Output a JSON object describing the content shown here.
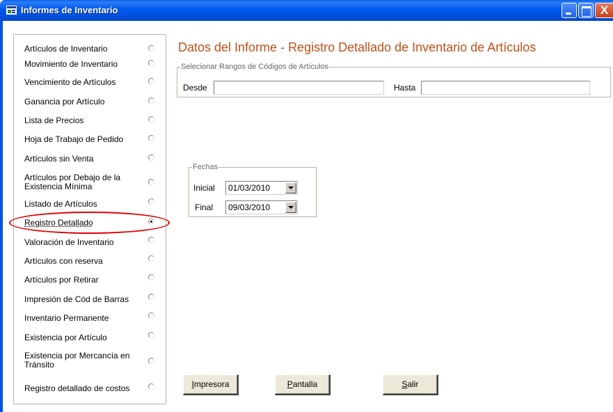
{
  "window": {
    "title": "Informes de Inventario",
    "close_glyph": "X"
  },
  "report_list": [
    {
      "label": "Artículos de Inventario",
      "selected": false
    },
    {
      "label": "Movimiento de Inventario",
      "selected": false
    },
    {
      "label": "Vencimiento de Artículos",
      "selected": false
    },
    {
      "label": "Ganancia por Artículo",
      "selected": false
    },
    {
      "label": "Lista de Precios",
      "selected": false
    },
    {
      "label": "Hoja de Trabajo de Pedido",
      "selected": false
    },
    {
      "label": "Artículos sin Venta",
      "selected": false
    },
    {
      "label": "Artículos por Debajo de la",
      "label2": "Existencia Mínima",
      "selected": false
    },
    {
      "label": "Listado de Artículos",
      "selected": false
    },
    {
      "label": "Registro Detallado",
      "selected": true
    },
    {
      "label": "Valoración de Inventario",
      "selected": false
    },
    {
      "label": "Artículos con reserva",
      "selected": false
    },
    {
      "label": "Artículos por Retirar",
      "selected": false
    },
    {
      "label": "Impresión de Cód de Barras",
      "selected": false
    },
    {
      "label": "Inventario Permanente",
      "selected": false
    },
    {
      "label": "Existencia por Artículo",
      "selected": false
    },
    {
      "label": "Existencia por Mercancía en",
      "label2": "Tránsito",
      "selected": false
    },
    {
      "label": "Registro detallado de costos",
      "selected": false
    }
  ],
  "main": {
    "title": "Datos del Informe - Registro Detallado de Inventario de Artículos",
    "range": {
      "legend": "Selecionar Rangos de Códigos de Artículos",
      "from_label": "Desde",
      "from_value": "",
      "to_label": "Hasta",
      "to_value": ""
    },
    "dates": {
      "legend": "Fechas",
      "start_label": "Inicial",
      "start_value": "01/03/2010",
      "end_label": "Final",
      "end_value": "09/03/2010"
    }
  },
  "buttons": {
    "print": {
      "mnemonic": "I",
      "rest": "mpresora"
    },
    "screen": {
      "mnemonic": "P",
      "rest": "antalla"
    },
    "exit": {
      "mnemonic": "S",
      "rest": "alir"
    }
  },
  "colors": {
    "title_bar": "#0054e3",
    "report_title": "#c0501a",
    "highlight": "#e00000"
  }
}
